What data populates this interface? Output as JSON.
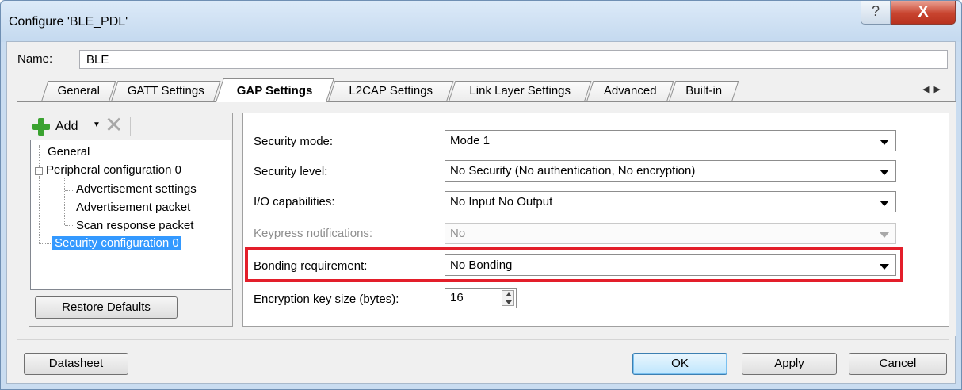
{
  "window": {
    "title": "Configure 'BLE_PDL'",
    "help_glyph": "?",
    "close_glyph": "X"
  },
  "name_field": {
    "label": "Name:",
    "value": "BLE"
  },
  "tabs": [
    {
      "label": "General",
      "active": false
    },
    {
      "label": "GATT Settings",
      "active": false
    },
    {
      "label": "GAP Settings",
      "active": true
    },
    {
      "label": "L2CAP Settings",
      "active": false
    },
    {
      "label": "Link Layer Settings",
      "active": false
    },
    {
      "label": "Advanced",
      "active": false
    },
    {
      "label": "Built-in",
      "active": false
    }
  ],
  "tab_scroll": {
    "left": "◀",
    "right": "▶"
  },
  "toolbar": {
    "add_label": "Add",
    "add_dropdown": "▼",
    "delete_glyph": "✕"
  },
  "tree": {
    "items": [
      {
        "label": "General"
      },
      {
        "label": "Peripheral configuration 0",
        "expander": "−"
      },
      {
        "label": "Advertisement settings"
      },
      {
        "label": "Advertisement packet"
      },
      {
        "label": "Scan response packet"
      },
      {
        "label": "Security configuration 0",
        "selected": true
      }
    ]
  },
  "restore_defaults_label": "Restore Defaults",
  "security": {
    "mode": {
      "label": "Security mode:",
      "value": "Mode 1"
    },
    "level": {
      "label": "Security level:",
      "value": "No Security (No authentication, No encryption)"
    },
    "io": {
      "label": "I/O capabilities:",
      "value": "No Input No Output"
    },
    "keypress": {
      "label": "Keypress notifications:",
      "value": "No",
      "disabled": true
    },
    "bonding": {
      "label": "Bonding requirement:",
      "value": "No Bonding"
    },
    "key_size": {
      "label": "Encryption key size (bytes):",
      "value": "16"
    }
  },
  "highlight_color": "#e31e2a",
  "footer": {
    "datasheet_label": "Datasheet",
    "ok_label": "OK",
    "apply_label": "Apply",
    "cancel_label": "Cancel"
  }
}
